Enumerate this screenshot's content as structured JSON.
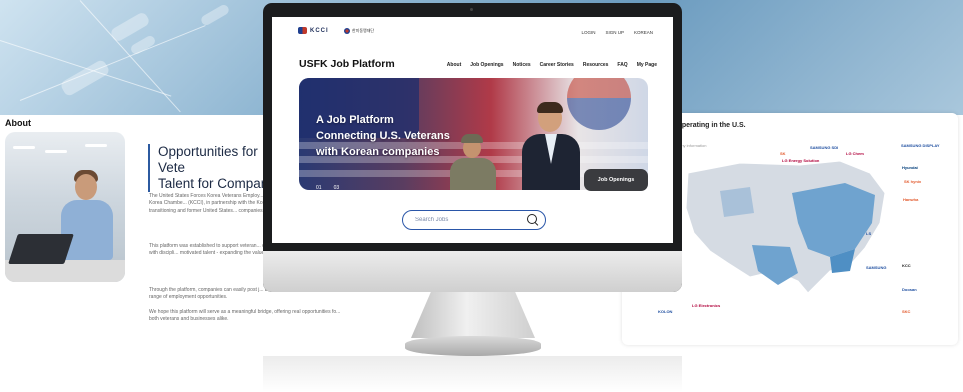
{
  "background": {
    "about_label": "About",
    "about_heading_line1": "Opportunities for Vete",
    "about_heading_line2": "Talent for Companies",
    "about_paragraph_1": "The United States Forces Korea Veterans Employ... matching platform operated by the Korea Chambe... (KCCI), in partnership with the Korea-U.S. Alliance... to connect transitioning and former United States... companies operating in the United States.",
    "about_paragraph_2": "This platform was established to support veteran... careers and to link Korean companies with discipli... motivated talent - expanding the value of the Kore... economic cooperation.",
    "about_paragraph_3": "Through the platform, companies can easily post j... browse and apply for a wide range of employment opportunities.",
    "about_paragraph_4": "We hope this platform will serve as a meaningful bridge, offering real opportunities fo... both veterans and businesses alike.",
    "map_title": "...perating in the U.S.",
    "map_subtitle": "...ny information",
    "map_logos": [
      "SAMSUNG DISPLAY",
      "SK",
      "LG Energy Solution",
      "Hyundai",
      "LG Chem",
      "SAMSUNG SDI",
      "SK hynix",
      "SAMSUNG",
      "LS",
      "Hanwha",
      "KCC",
      "Doosan",
      "SKC",
      "KOLON",
      "LG Electronics"
    ]
  },
  "header": {
    "kcci_logo": "KCCI",
    "partner_logo": "한미동맹재단",
    "util_links": [
      "LOGIN",
      "SIGN UP",
      "KOREAN"
    ]
  },
  "site": {
    "title": "USFK Job Platform",
    "nav": [
      "About",
      "Job Openings",
      "Notices",
      "Career Stories",
      "Resources",
      "FAQ",
      "My Page"
    ]
  },
  "banner": {
    "headline_line1": "A Job Platform",
    "headline_line2": "Connecting U.S. Veterans",
    "headline_line3": "with Korean companies",
    "page_current": "01",
    "page_total": "03",
    "cta": "Job Openings"
  },
  "search": {
    "placeholder": "Search Jobs"
  }
}
